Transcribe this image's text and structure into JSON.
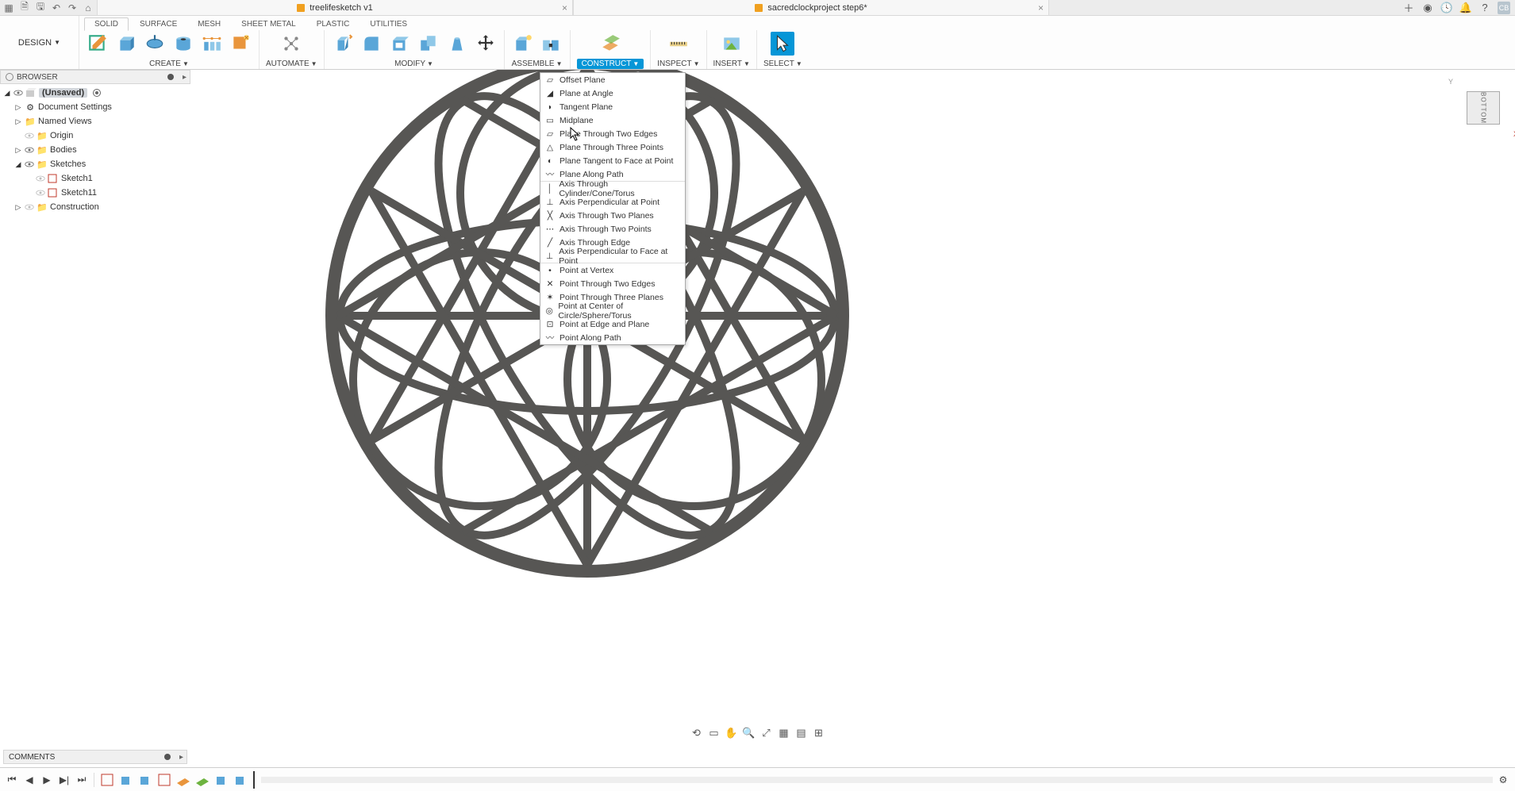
{
  "appbar": {
    "tabs": [
      {
        "title": "treelifesketch v1"
      },
      {
        "title": "sacredclockproject step6*"
      }
    ],
    "avatar": "CB"
  },
  "ribbon": {
    "design_label": "DESIGN",
    "tabs": [
      "SOLID",
      "SURFACE",
      "MESH",
      "SHEET METAL",
      "PLASTIC",
      "UTILITIES"
    ],
    "groups": {
      "create": "CREATE",
      "automate": "AUTOMATE",
      "modify": "MODIFY",
      "assemble": "ASSEMBLE",
      "construct": "CONSTRUCT",
      "inspect": "INSPECT",
      "insert": "INSERT",
      "select": "SELECT"
    }
  },
  "browser": {
    "title": "BROWSER",
    "root": "(Unsaved)",
    "items": [
      "Document Settings",
      "Named Views",
      "Origin",
      "Bodies",
      "Sketches",
      "Sketch1",
      "Sketch11",
      "Construction"
    ]
  },
  "construct_menu": {
    "planes": [
      "Offset Plane",
      "Plane at Angle",
      "Tangent Plane",
      "Midplane",
      "Plane Through Two Edges",
      "Plane Through Three Points",
      "Plane Tangent to Face at Point",
      "Plane Along Path"
    ],
    "axes": [
      "Axis Through Cylinder/Cone/Torus",
      "Axis Perpendicular at Point",
      "Axis Through Two Planes",
      "Axis Through Two Points",
      "Axis Through Edge",
      "Axis Perpendicular to Face at Point"
    ],
    "points": [
      "Point at Vertex",
      "Point Through Two Edges",
      "Point Through Three Planes",
      "Point at Center of Circle/Sphere/Torus",
      "Point at Edge and Plane",
      "Point Along Path"
    ]
  },
  "comments": {
    "title": "COMMENTS"
  },
  "viewcube": {
    "face": "BOTTOM",
    "y": "Y",
    "x": "X"
  }
}
